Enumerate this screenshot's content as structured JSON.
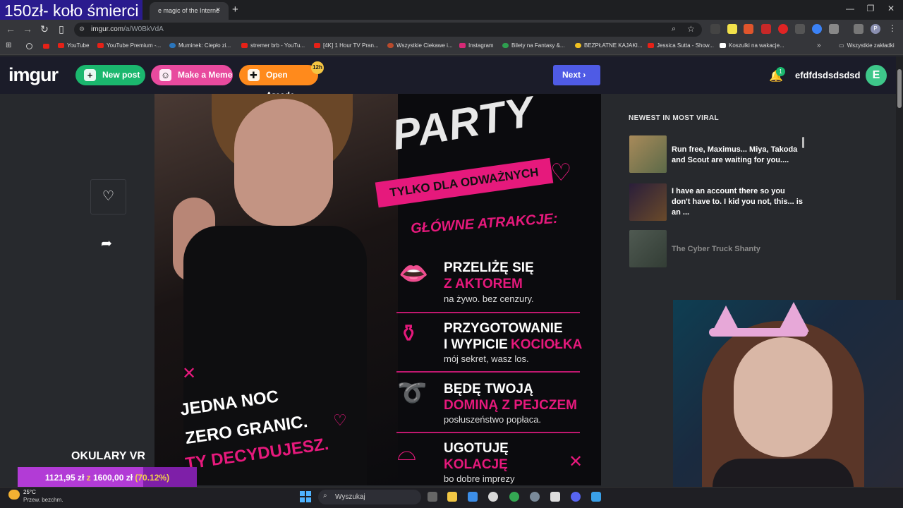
{
  "overlay": {
    "title": "150zł- koło śmierci"
  },
  "browser": {
    "active_tab": "e magic of the Interne",
    "tab_close": "×",
    "new_tab": "+",
    "win_min": "—",
    "win_max": "❐",
    "win_close": "✕",
    "url_host": "imgur.com",
    "url_path": "/a/W0BkVdA",
    "bookmarks": [
      "YouTube",
      "YouTube Premium -...",
      "Muminek: Ciepło zi...",
      "stremer brb - YouTu...",
      "[4K] 1 Hour TV Pran...",
      "Wszystkie Ciekawe i...",
      "Instagram",
      "Bilety na Fantasy &...",
      "BEZPŁATNE KAJAKI...",
      "Jessica Sutta - Show...",
      "Koszulki na wakacje..."
    ],
    "all_bookmarks": "Wszystkie zakładki",
    "profile_initial": "P"
  },
  "imgur": {
    "logo": "imgur",
    "new_post": "New post",
    "make_meme": "Make a Meme",
    "open_arcade": "Open Arcade",
    "arcade_badge": "12h",
    "next": "Next",
    "notif_count": "1",
    "username": "efdfdsdsdsdsd",
    "avatar_initial": "E"
  },
  "poster": {
    "party": "PARTY",
    "banner": "TYLKO DLA ODWAŻNYCH",
    "attractions": "GŁÓWNE ATRAKCJE:",
    "items": [
      {
        "title": "PRZELIŻĘ SIĘ",
        "pink": "Z AKTOREM",
        "sub": "na żywo. bez cenzury."
      },
      {
        "title": "PRZYGOTOWANIE",
        "title2": "I WYPICIE",
        "pink": "KOCIOŁKA",
        "sub": "mój sekret, wasz los."
      },
      {
        "title": "BĘDĘ TWOJĄ",
        "pink": "DOMINĄ Z PEJCZEM",
        "sub": "posłuszeństwo popłaca."
      },
      {
        "title": "UGOTUJĘ",
        "pink": "KOLACJĘ",
        "sub": "bo dobre imprezy"
      }
    ],
    "left_line1": "JEDNA NOC",
    "left_line2": "ZERO GRANIC.",
    "left_line3": "TY DECYDUJESZ."
  },
  "sidebar": {
    "title": "NEWEST IN MOST VIRAL",
    "posts": [
      {
        "text": "Run free, Maximus... Miya, Takoda and Scout are waiting for you...."
      },
      {
        "text": "I have an account there so you don't have to. I kid you not, this... is an ..."
      },
      {
        "text": "The Cyber Truck Shanty"
      }
    ]
  },
  "goal": {
    "label": "OKULARY VR",
    "current": "1121,95 zł",
    "sep": "z",
    "target": "1600,00 zł",
    "percent": "(70.12%)",
    "progress": 0.7012
  },
  "taskbar": {
    "temp": "25°C",
    "weather": "Przew. bezchm.",
    "search": "Wyszukaj"
  },
  "colors": {
    "imgur_green": "#1bb76e",
    "imgur_pink": "#e84a9e",
    "imgur_orange": "#ff8a1c",
    "next_blue": "#4f5be5",
    "poster_pink": "#e6197c"
  }
}
